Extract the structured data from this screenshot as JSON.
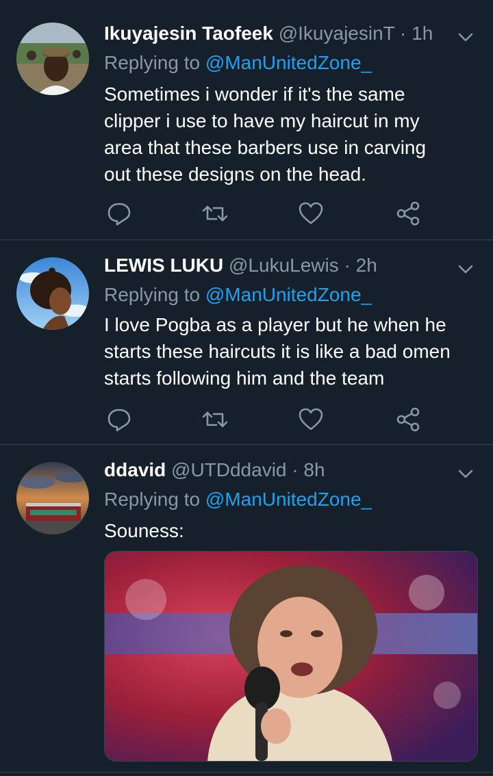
{
  "tweets": [
    {
      "name": "Ikuyajesin Taofeek",
      "handle": "@IkuyajesinT",
      "time": "1h",
      "replying_prefix": "Replying to",
      "replying_to": "@ManUnitedZone_",
      "lines": [
        "Sometimes i wonder if it's the same",
        "clipper i use to have my haircut in my",
        "area that these barbers use in carving",
        "out these designs on the head."
      ]
    },
    {
      "name": "LEWIS LUKU",
      "handle": "@LukuLewis",
      "time": "2h",
      "replying_prefix": "Replying to",
      "replying_to": "@ManUnitedZone_",
      "lines": [
        "I love Pogba as a player but he when he",
        "starts these haircuts it is like a bad omen",
        "starts following him and the team"
      ]
    },
    {
      "name": "ddavid",
      "handle": "@UTDddavid",
      "time": "8h",
      "replying_prefix": "Replying to",
      "replying_to": "@ManUnitedZone_",
      "lines": [
        "Souness:"
      ]
    }
  ],
  "colors": {
    "background": "#15202b",
    "secondary_text": "#8899a6",
    "link": "#1da1f2",
    "divider": "#38444d"
  },
  "icons": [
    "reply-icon",
    "retweet-icon",
    "like-icon",
    "share-icon",
    "chevron-down-icon"
  ]
}
